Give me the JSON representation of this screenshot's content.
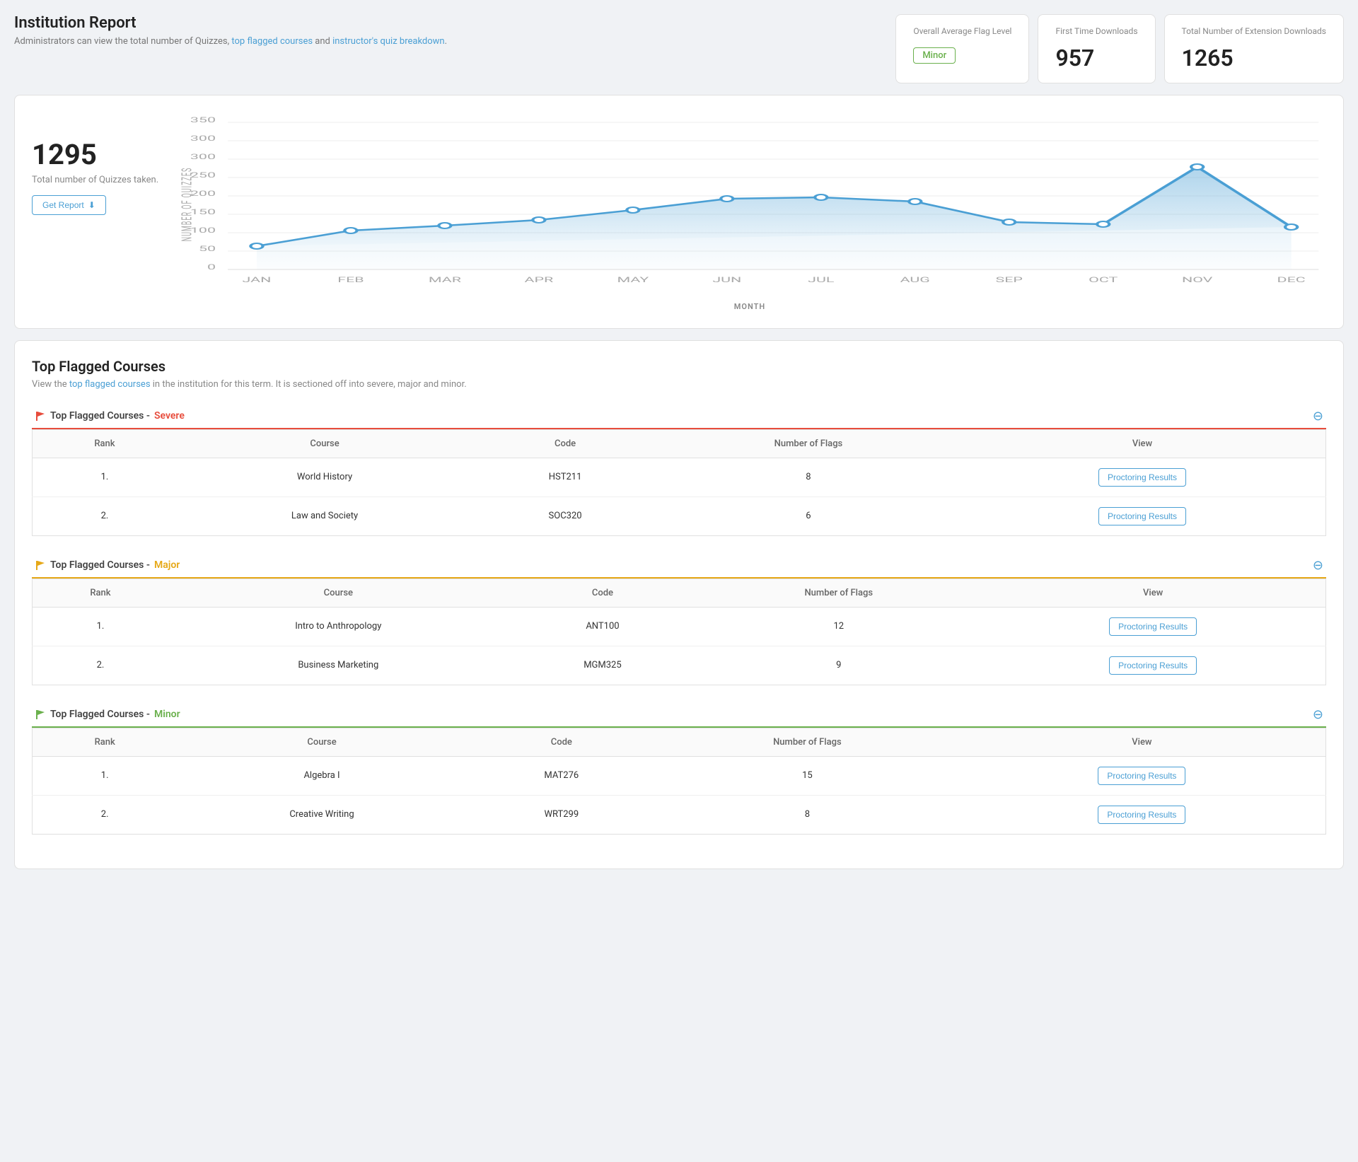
{
  "header": {
    "title": "Institution Report",
    "subtitle_text": "Administrators can view the total number of Quizzes, top flagged courses and instructor's quiz breakdown.",
    "subtitle_link1": "top flagged courses",
    "subtitle_link2": "instructor's quiz breakdown"
  },
  "stats": {
    "flag_level_label": "Overall Average Flag Level",
    "flag_level_value": "Minor",
    "downloads_first_label": "First Time Downloads",
    "downloads_first_value": "957",
    "downloads_total_label": "Total Number of Extension Downloads",
    "downloads_total_value": "1265"
  },
  "quiz_chart": {
    "count": "1295",
    "count_label": "Total number of Quizzes taken.",
    "get_report_label": "Get Report",
    "x_axis_label": "MONTH",
    "y_axis_label": "NUMBER OF QUIZZES",
    "months": [
      "JAN",
      "FEB",
      "MAR",
      "APR",
      "MAY",
      "JUN",
      "JUL",
      "AUG",
      "SEP",
      "OCT",
      "NOV",
      "DEC"
    ],
    "values": [
      55,
      90,
      105,
      120,
      145,
      170,
      175,
      165,
      110,
      105,
      240,
      95
    ]
  },
  "top_flagged": {
    "title": "Top Flagged Courses",
    "subtitle": "View the top flagged courses in the institution for this term. It is sectioned off into severe, major and minor.",
    "severe": {
      "label": "Top Flagged Courses - ",
      "severity": "Severe",
      "columns": [
        "Rank",
        "Course",
        "Code",
        "Number of Flags",
        "View"
      ],
      "rows": [
        {
          "rank": "1.",
          "course": "World History",
          "code": "HST211",
          "flags": "8",
          "btn": "Proctoring Results"
        },
        {
          "rank": "2.",
          "course": "Law and Society",
          "code": "SOC320",
          "flags": "6",
          "btn": "Proctoring Results"
        }
      ]
    },
    "major": {
      "label": "Top Flagged Courses - ",
      "severity": "Major",
      "columns": [
        "Rank",
        "Course",
        "Code",
        "Number of Flags",
        "View"
      ],
      "rows": [
        {
          "rank": "1.",
          "course": "Intro to Anthropology",
          "code": "ANT100",
          "flags": "12",
          "btn": "Proctoring Results"
        },
        {
          "rank": "2.",
          "course": "Business Marketing",
          "code": "MGM325",
          "flags": "9",
          "btn": "Proctoring Results"
        }
      ]
    },
    "minor": {
      "label": "Top Flagged Courses - ",
      "severity": "Minor",
      "columns": [
        "Rank",
        "Course",
        "Code",
        "Number of Flags",
        "View"
      ],
      "rows": [
        {
          "rank": "1.",
          "course": "Algebra I",
          "code": "MAT276",
          "flags": "15",
          "btn": "Proctoring Results"
        },
        {
          "rank": "2.",
          "course": "Creative Writing",
          "code": "WRT299",
          "flags": "8",
          "btn": "Proctoring Results"
        }
      ]
    }
  }
}
